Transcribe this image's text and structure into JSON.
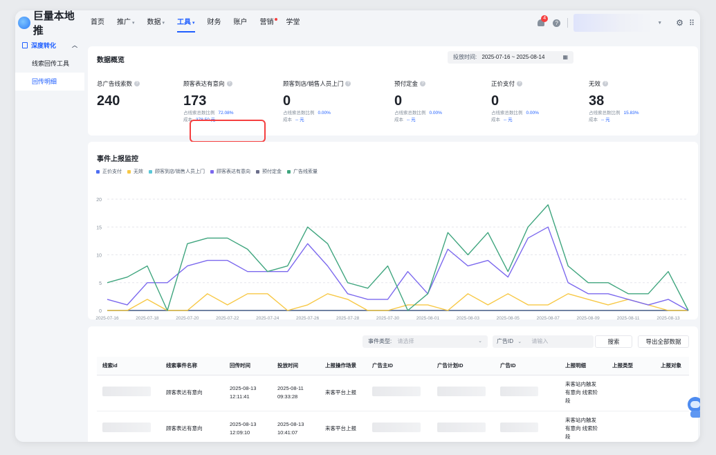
{
  "app": {
    "logo_text": "巨量本地推"
  },
  "nav": {
    "items": [
      {
        "label": "首页",
        "caret": false,
        "active": false,
        "dot": false
      },
      {
        "label": "推广",
        "caret": true,
        "active": false,
        "dot": false
      },
      {
        "label": "数据",
        "caret": true,
        "active": false,
        "dot": false
      },
      {
        "label": "工具",
        "caret": true,
        "active": true,
        "dot": false
      },
      {
        "label": "财务",
        "caret": false,
        "active": false,
        "dot": false
      },
      {
        "label": "账户",
        "caret": false,
        "active": false,
        "dot": false
      },
      {
        "label": "营销",
        "caret": false,
        "active": false,
        "dot": true
      },
      {
        "label": "学堂",
        "caret": false,
        "active": false,
        "dot": false
      }
    ],
    "notification_count": "4"
  },
  "sidebar": {
    "group_label": "深度转化",
    "items": [
      {
        "label": "线索回传工具",
        "active": false
      },
      {
        "label": "回传明细",
        "active": true
      }
    ]
  },
  "overview": {
    "title": "数据概览",
    "date_label": "投放时间:",
    "date_range": "2025-07-16 ~ 2025-08-14",
    "metrics": [
      {
        "label": "总广告线索数",
        "value": "240",
        "ratio_label": "",
        "ratio": "",
        "cost_label": "",
        "cost": ""
      },
      {
        "label": "顾客表达有意向",
        "value": "173",
        "ratio_label": "占线索总数比例",
        "ratio": "72.08%",
        "cost_label": "成本",
        "cost": "378.50 元"
      },
      {
        "label": "顾客到店/销售人员上门",
        "value": "0",
        "ratio_label": "占线索总数比例",
        "ratio": "0.00%",
        "cost_label": "成本",
        "cost": "-- 元"
      },
      {
        "label": "预付定金",
        "value": "0",
        "ratio_label": "占线索总数比例",
        "ratio": "0.00%",
        "cost_label": "成本",
        "cost": "-- 元"
      },
      {
        "label": "正价支付",
        "value": "0",
        "ratio_label": "占线索总数比例",
        "ratio": "0.00%",
        "cost_label": "成本",
        "cost": "-- 元"
      },
      {
        "label": "无效",
        "value": "38",
        "ratio_label": "占线索总数比例",
        "ratio": "15.83%",
        "cost_label": "成本",
        "cost": "-- 元"
      }
    ]
  },
  "monitor": {
    "title": "事件上报监控",
    "colors": {
      "pay": "#4e6ef2",
      "invalid": "#f7c845",
      "visit": "#5ac8d8",
      "intent": "#7b68ee",
      "deposit": "#6b6e8a",
      "leads": "#3fa57e"
    }
  },
  "chart_data": {
    "type": "line",
    "x": [
      "2025-07-16",
      "2025-07-17",
      "2025-07-18",
      "2025-07-19",
      "2025-07-20",
      "2025-07-21",
      "2025-07-22",
      "2025-07-23",
      "2025-07-24",
      "2025-07-25",
      "2025-07-26",
      "2025-07-27",
      "2025-07-28",
      "2025-07-29",
      "2025-07-30",
      "2025-07-31",
      "2025-08-01",
      "2025-08-02",
      "2025-08-03",
      "2025-08-04",
      "2025-08-05",
      "2025-08-06",
      "2025-08-07",
      "2025-08-08",
      "2025-08-09",
      "2025-08-10",
      "2025-08-11",
      "2025-08-12",
      "2025-08-13",
      "2025-08-14"
    ],
    "tick_labels": [
      "2025-07-16",
      "2025-07-18",
      "2025-07-20",
      "2025-07-22",
      "2025-07-24",
      "2025-07-26",
      "2025-07-28",
      "2025-07-30",
      "2025-08-01",
      "2025-08-03",
      "2025-08-05",
      "2025-08-07",
      "2025-08-09",
      "2025-08-11",
      "2025-08-13"
    ],
    "ylim": [
      0,
      20
    ],
    "yticks": [
      0,
      5,
      10,
      15,
      20
    ],
    "series": [
      {
        "name": "正价支付",
        "key": "pay",
        "values": [
          0,
          0,
          0,
          0,
          0,
          0,
          0,
          0,
          0,
          0,
          0,
          0,
          0,
          0,
          0,
          0,
          0,
          0,
          0,
          0,
          0,
          0,
          0,
          0,
          0,
          0,
          0,
          0,
          0,
          0
        ]
      },
      {
        "name": "无效",
        "key": "invalid",
        "values": [
          0,
          0,
          2,
          0,
          0,
          3,
          1,
          3,
          3,
          0,
          1,
          3,
          2,
          0,
          0,
          1,
          1,
          0,
          3,
          1,
          3,
          1,
          1,
          3,
          2,
          1,
          2,
          1,
          0,
          0
        ]
      },
      {
        "name": "顾客到店/销售人员上门",
        "key": "visit",
        "values": [
          0,
          0,
          0,
          0,
          0,
          0,
          0,
          0,
          0,
          0,
          0,
          0,
          0,
          0,
          0,
          0,
          0,
          0,
          0,
          0,
          0,
          0,
          0,
          0,
          0,
          0,
          0,
          0,
          0,
          0
        ]
      },
      {
        "name": "顾客表达有意向",
        "key": "intent",
        "values": [
          2,
          1,
          5,
          5,
          8,
          9,
          9,
          7,
          7,
          7,
          12,
          8,
          3,
          2,
          2,
          7,
          3,
          11,
          8,
          9,
          6,
          13,
          15,
          5,
          3,
          3,
          2,
          1,
          2,
          0
        ]
      },
      {
        "name": "预付定金",
        "key": "deposit",
        "values": [
          0,
          0,
          0,
          0,
          0,
          0,
          0,
          0,
          0,
          0,
          0,
          0,
          0,
          0,
          0,
          0,
          0,
          0,
          0,
          0,
          0,
          0,
          0,
          0,
          0,
          0,
          0,
          0,
          0,
          0
        ]
      },
      {
        "name": "广告线索量",
        "key": "leads",
        "values": [
          5,
          6,
          8,
          0,
          12,
          13,
          13,
          11,
          7,
          8,
          15,
          12,
          5,
          4,
          8,
          0,
          3,
          14,
          10,
          14,
          7,
          15,
          19,
          8,
          5,
          5,
          3,
          3,
          7,
          0
        ]
      }
    ]
  },
  "details": {
    "filter_event_label": "事件类型:",
    "filter_event_placeholder": "请选择",
    "filter_id_label": "广告ID",
    "filter_id_placeholder": "请输入",
    "search_label": "搜索",
    "export_label": "导出全部数据",
    "columns": [
      "线索id",
      "线索事件名称",
      "回传时间",
      "投放时间",
      "上报操作场景",
      "广告主ID",
      "广告计划ID",
      "广告ID",
      "上报明细",
      "上报类型",
      "上报对象"
    ],
    "rows": [
      {
        "event": "顾客表达有意向",
        "report_time": "2025-08-13 12:11:41",
        "ad_time": "2025-08-11 09:33:28",
        "scene": "来客平台上报",
        "detail": "来客站内触发有意向 线索阶段"
      },
      {
        "event": "顾客表达有意向",
        "report_time": "2025-08-13 12:09:10",
        "ad_time": "2025-08-13 10:41:07",
        "scene": "来客平台上报",
        "detail": "来客站内触发有意向 线索阶段"
      }
    ]
  }
}
